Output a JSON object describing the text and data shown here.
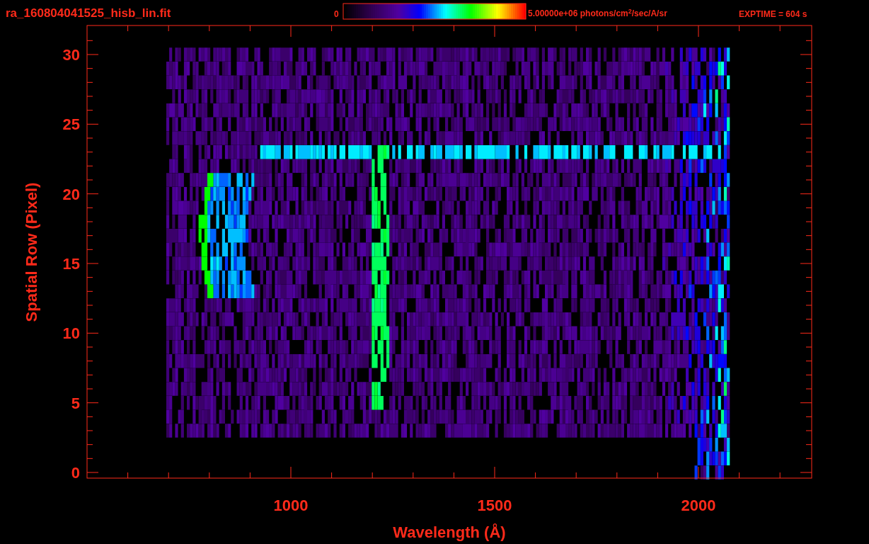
{
  "title": "ra_160804041525_hisb_lin.fit",
  "colorbar": {
    "min_label": "0",
    "max_label": "5.00000e+06 photons/cm$^{2}$/sec/A/sr"
  },
  "exposure": "EXPTIME = 604 s",
  "plot": {
    "ylabel": "Spatial Row (Pixel)",
    "xlabel": "Wavelength (Å)",
    "xticks": [
      "1000",
      "1500",
      "2000"
    ],
    "yticks": [
      "30",
      "25",
      "20",
      "15",
      "10",
      "5",
      "0"
    ]
  }
}
